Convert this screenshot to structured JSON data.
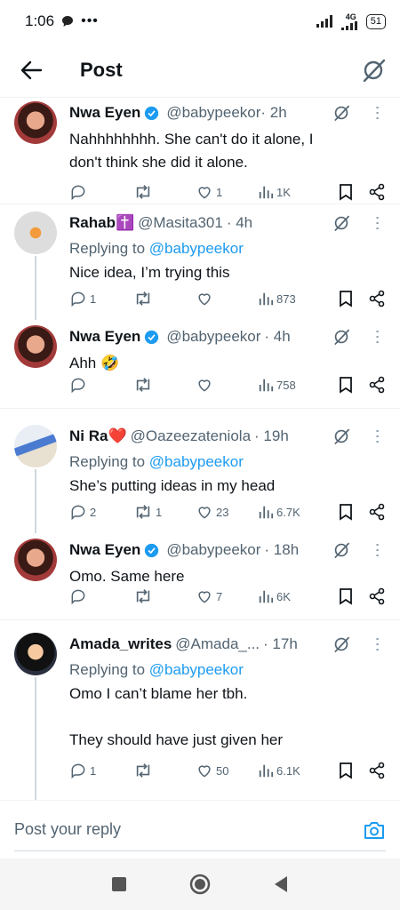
{
  "status": {
    "time": "1:06",
    "network": "4G",
    "battery": "51"
  },
  "header": {
    "title": "Post"
  },
  "tweets": [
    {
      "name": "Nwa Eyen",
      "handle": "@babypeekor",
      "time": "· 2h",
      "replying_prefix": "",
      "replying_handle": "",
      "text_lines": [
        "Nahhhhhhhh. She can't do it alone, I",
        "don't think she did it alone."
      ],
      "replies": "",
      "reposts": "",
      "likes": "1",
      "views": "1K"
    },
    {
      "name": "Rahab✝️",
      "handle": "@Masita301",
      "time": "· 4h",
      "replying_prefix": "Replying to ",
      "replying_handle": "@babypeekor",
      "text_lines": [
        "Nice idea, I’m trying this"
      ],
      "replies": "1",
      "reposts": "",
      "likes": "",
      "views": "873"
    },
    {
      "name": "Nwa Eyen",
      "handle": "@babypeekor",
      "time": "· 4h",
      "replying_prefix": "",
      "replying_handle": "",
      "text_lines": [
        "Ahh 🤣"
      ],
      "replies": "",
      "reposts": "",
      "likes": "",
      "views": "758"
    },
    {
      "name": "Ni Ra❤️",
      "handle": "@Oazeezateniola",
      "time": "· 19h",
      "replying_prefix": "Replying to ",
      "replying_handle": "@babypeekor",
      "text_lines": [
        "She’s putting ideas in my head"
      ],
      "replies": "2",
      "reposts": "1",
      "likes": "23",
      "views": "6.7K"
    },
    {
      "name": "Nwa Eyen",
      "handle": "@babypeekor",
      "time": "· 18h",
      "replying_prefix": "",
      "replying_handle": "",
      "text_lines": [
        "Omo. Same here"
      ],
      "replies": "",
      "reposts": "",
      "likes": "7",
      "views": "6K"
    },
    {
      "name": "Amada_writes",
      "handle": "@Amada_...",
      "time": "· 17h",
      "replying_prefix": "Replying to ",
      "replying_handle": "@babypeekor",
      "text_lines": [
        "Omo I can’t blame her tbh.",
        "",
        "They should have just given her"
      ],
      "replies": "1",
      "reposts": "",
      "likes": "50",
      "views": "6.1K"
    }
  ],
  "reply_bar": {
    "placeholder": "Post your reply"
  },
  "colors": {
    "accent": "#1d9bf0",
    "verified": "#1d9bf0",
    "muted": "#536471",
    "thread_line": "#cfd9de"
  },
  "icons": [
    "back-arrow-icon",
    "grok-icon",
    "more-icon",
    "reply-icon",
    "repost-icon",
    "like-icon",
    "views-icon",
    "bookmark-icon",
    "share-icon",
    "camera-icon",
    "recents-icon",
    "home-icon",
    "back-icon"
  ]
}
